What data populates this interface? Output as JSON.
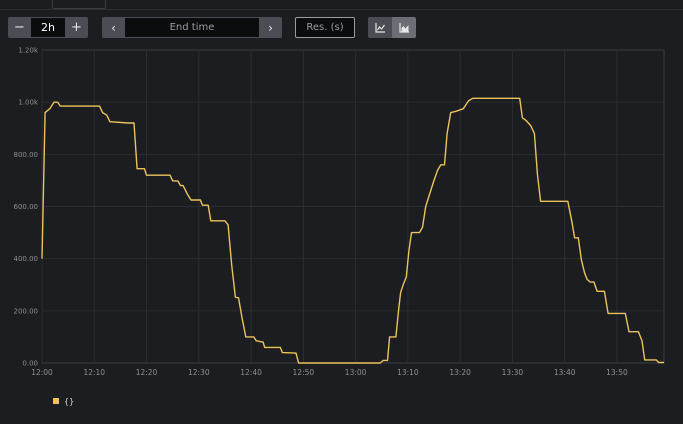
{
  "header": {
    "tab_label": ""
  },
  "controls": {
    "range": {
      "decrease_label": "−",
      "value": "2h",
      "increase_label": "+"
    },
    "end_time": {
      "back_label": "‹",
      "placeholder": "End time",
      "forward_label": "›"
    },
    "resolution": {
      "placeholder": "Res. (s)"
    },
    "chart_type": {
      "options": [
        "line-chart-icon",
        "stacked-chart-icon"
      ],
      "selected": "stacked-chart-icon"
    }
  },
  "colors": {
    "series": "#ecc35b",
    "grid": "#2a2d31",
    "axis_text": "#8e9094",
    "background": "#1b1d21"
  },
  "chart_data": {
    "type": "line",
    "x_ticks": [
      "12:00",
      "12:10",
      "12:20",
      "12:30",
      "12:40",
      "12:50",
      "13:00",
      "13:10",
      "13:20",
      "13:30",
      "13:40",
      "13:50"
    ],
    "y_ticks": [
      "0.00",
      "200.00",
      "400.00",
      "600.00",
      "800.00",
      "1.00k",
      "1.20k"
    ],
    "xlim": [
      0,
      119
    ],
    "ylim": [
      0,
      1200
    ],
    "grid": true,
    "legend_position": "bottom-left",
    "series": [
      {
        "name": "{}",
        "color": "#ecc35b",
        "points": [
          [
            0,
            400
          ],
          [
            0.6,
            960
          ],
          [
            1.5,
            975
          ],
          [
            2.3,
            1000
          ],
          [
            3,
            1000
          ],
          [
            3.5,
            985
          ],
          [
            11,
            985
          ],
          [
            11.6,
            960
          ],
          [
            12.4,
            950
          ],
          [
            13,
            925
          ],
          [
            16.5,
            920
          ],
          [
            17.6,
            920
          ],
          [
            18.2,
            745
          ],
          [
            19.6,
            745
          ],
          [
            20,
            720
          ],
          [
            24.5,
            720
          ],
          [
            25,
            698
          ],
          [
            26,
            698
          ],
          [
            26.5,
            680
          ],
          [
            27,
            680
          ],
          [
            27.8,
            648
          ],
          [
            28.5,
            625
          ],
          [
            30.3,
            625
          ],
          [
            30.7,
            605
          ],
          [
            31.8,
            605
          ],
          [
            32.3,
            545
          ],
          [
            35,
            545
          ],
          [
            35.6,
            530
          ],
          [
            36.3,
            375
          ],
          [
            37,
            252
          ],
          [
            37.6,
            250
          ],
          [
            38.3,
            170
          ],
          [
            39,
            100
          ],
          [
            40.5,
            100
          ],
          [
            41,
            85
          ],
          [
            42.3,
            80
          ],
          [
            42.6,
            60
          ],
          [
            45.6,
            60
          ],
          [
            46,
            40
          ],
          [
            48.6,
            38
          ],
          [
            49.1,
            0
          ],
          [
            52,
            0
          ],
          [
            64.7,
            0
          ],
          [
            65.3,
            10
          ],
          [
            66.1,
            10
          ],
          [
            66.5,
            100
          ],
          [
            67.7,
            100
          ],
          [
            68.2,
            200
          ],
          [
            68.6,
            270
          ],
          [
            69.1,
            300
          ],
          [
            69.7,
            330
          ],
          [
            70.2,
            430
          ],
          [
            70.7,
            500
          ],
          [
            72.2,
            500
          ],
          [
            72.8,
            520
          ],
          [
            73.4,
            600
          ],
          [
            74.2,
            650
          ],
          [
            75,
            700
          ],
          [
            75.7,
            740
          ],
          [
            76.3,
            760
          ],
          [
            77,
            760
          ],
          [
            77.5,
            880
          ],
          [
            78.2,
            960
          ],
          [
            79.2,
            965
          ],
          [
            80.6,
            975
          ],
          [
            81.6,
            1005
          ],
          [
            82.4,
            1015
          ],
          [
            91.4,
            1015
          ],
          [
            91.9,
            940
          ],
          [
            92.6,
            930
          ],
          [
            93.5,
            910
          ],
          [
            94.2,
            880
          ],
          [
            94.8,
            720
          ],
          [
            95.4,
            620
          ],
          [
            100.6,
            620
          ],
          [
            101.4,
            540
          ],
          [
            101.9,
            480
          ],
          [
            102.6,
            480
          ],
          [
            103.2,
            395
          ],
          [
            103.8,
            345
          ],
          [
            104.3,
            320
          ],
          [
            104.9,
            310
          ],
          [
            105.6,
            310
          ],
          [
            106.2,
            275
          ],
          [
            107.6,
            275
          ],
          [
            108.3,
            190
          ],
          [
            111.6,
            190
          ],
          [
            112.3,
            120
          ],
          [
            114.1,
            120
          ],
          [
            114.8,
            85
          ],
          [
            115.3,
            12
          ],
          [
            117.5,
            12
          ],
          [
            118,
            2
          ],
          [
            119,
            2
          ]
        ]
      }
    ]
  },
  "legend": {
    "items": [
      {
        "label": "{}"
      }
    ]
  }
}
